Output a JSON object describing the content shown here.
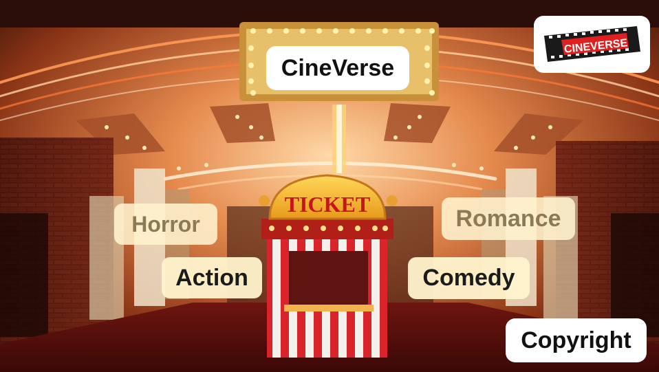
{
  "header": {
    "title": "CineVerse"
  },
  "logo": {
    "text": "CINEVERSE"
  },
  "booth": {
    "sign": "TICKET"
  },
  "genres": {
    "horror": "Horror",
    "action": "Action",
    "romance": "Romance",
    "comedy": "Comedy"
  },
  "footer": {
    "copyright": "Copyright"
  },
  "colors": {
    "booth_red": "#d8242a",
    "carpet_red": "#8a1510",
    "marquee_gold": "#e2b14a",
    "button_cream": "#fff3ce"
  }
}
